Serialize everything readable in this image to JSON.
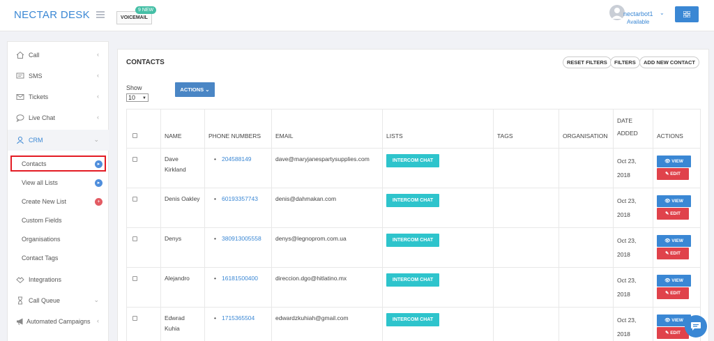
{
  "header": {
    "brand": "NECTAR DESK",
    "voicemail_label": "VOICEMAIL",
    "voicemail_badge": "9 NEW",
    "user_name": "nectarbot1",
    "user_status": "Available",
    "accent": "#3a87d4"
  },
  "sidebar": {
    "items": [
      {
        "label": "Call",
        "icon": "home-icon"
      },
      {
        "label": "SMS",
        "icon": "sms-icon"
      },
      {
        "label": "Tickets",
        "icon": "envelope-icon"
      },
      {
        "label": "Live Chat",
        "icon": "chat-bubble-icon"
      },
      {
        "label": "CRM",
        "icon": "user-icon"
      },
      {
        "label": "Integrations",
        "icon": "handshake-icon"
      },
      {
        "label": "Call Queue",
        "icon": "hourglass-icon"
      },
      {
        "label": "Automated Campaigns",
        "icon": "megaphone-icon"
      }
    ],
    "crm_sub": [
      {
        "label": "Contacts"
      },
      {
        "label": "View all Lists"
      },
      {
        "label": "Create New List"
      },
      {
        "label": "Custom Fields"
      },
      {
        "label": "Organisations"
      },
      {
        "label": "Contact Tags"
      }
    ]
  },
  "main": {
    "title": "CONTACTS",
    "buttons": {
      "reset": "RESET FILTERS",
      "filters": "FILTERS",
      "add": "ADD NEW CONTACT"
    },
    "show_label": "Show",
    "show_value": "10",
    "actions_label": "ACTIONS",
    "columns": [
      "NAME",
      "PHONE NUMBERS",
      "EMAIL",
      "LISTS",
      "TAGS",
      "ORGANISATION",
      "DATE ADDED",
      "ACTIONS"
    ],
    "view_label": "VIEW",
    "edit_label": "EDIT",
    "rows": [
      {
        "name": "Dave Kirkland",
        "phone": "204588149",
        "email": "dave@maryjanespartysupplies.com",
        "list": "INTERCOM CHAT",
        "date": "Oct 23, 2018"
      },
      {
        "name": "Denis Oakley",
        "phone": "60193357743",
        "email": "denis@dahmakan.com",
        "list": "INTERCOM CHAT",
        "date": "Oct 23, 2018"
      },
      {
        "name": "Denys",
        "phone": "380913005558",
        "email": "denys@legnoprom.com.ua",
        "list": "INTERCOM CHAT",
        "date": "Oct 23, 2018"
      },
      {
        "name": "Alejandro",
        "phone": "16181500400",
        "email": "direccion.dgo@hitlatino.mx",
        "list": "INTERCOM CHAT",
        "date": "Oct 23, 2018"
      },
      {
        "name": "Edwrad Kuhia",
        "phone": "1715365504",
        "email": "edwardzkuhiah@gmail.com",
        "list": "INTERCOM CHAT",
        "date": "Oct 23, 2018"
      }
    ]
  }
}
